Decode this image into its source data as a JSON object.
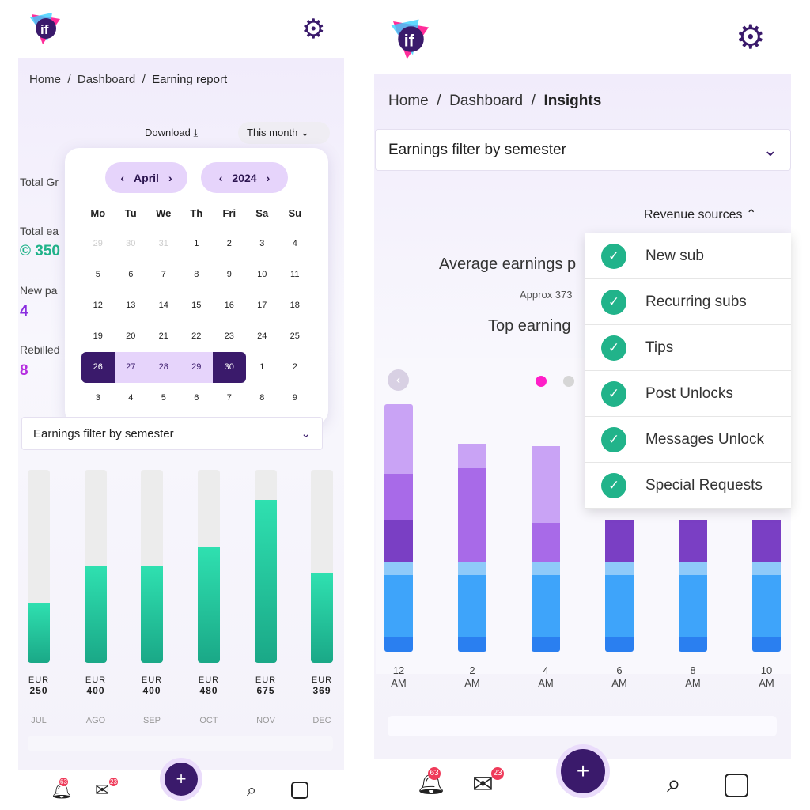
{
  "left": {
    "breadcrumb": [
      "Home",
      "Dashboard",
      "Earning report"
    ],
    "download_label": "Download",
    "period_select": "This month",
    "stats": [
      {
        "label": "Total Gr"
      },
      {
        "label": "Total ea",
        "value": "350"
      },
      {
        "label": "New pa",
        "value": "4"
      },
      {
        "label": "Rebilled",
        "value": "8"
      }
    ],
    "calendar": {
      "month": "April",
      "year": "2024",
      "weekdays": [
        "Mo",
        "Tu",
        "We",
        "Th",
        "Fri",
        "Sa",
        "Su"
      ],
      "days": [
        "29",
        "30",
        "31",
        "1",
        "2",
        "3",
        "4",
        "5",
        "6",
        "7",
        "8",
        "9",
        "10",
        "11",
        "12",
        "13",
        "14",
        "15",
        "16",
        "17",
        "18",
        "19",
        "20",
        "21",
        "22",
        "23",
        "24",
        "25",
        "26",
        "27",
        "28",
        "29",
        "30",
        "1",
        "2",
        "3",
        "4",
        "5",
        "6",
        "7",
        "8",
        "9"
      ],
      "range_start": "26",
      "range_end": "30"
    },
    "filter_select": "Earnings filter by semester",
    "bars": [
      {
        "currency": "EUR",
        "value": 250,
        "month": "JUL"
      },
      {
        "currency": "EUR",
        "value": 400,
        "month": "AGO"
      },
      {
        "currency": "EUR",
        "value": 400,
        "month": "SEP"
      },
      {
        "currency": "EUR",
        "value": 480,
        "month": "OCT"
      },
      {
        "currency": "EUR",
        "value": 675,
        "month": "NOV"
      },
      {
        "currency": "EUR",
        "value": 369,
        "month": "DEC"
      }
    ],
    "badges": {
      "notifications": "63",
      "messages": "23"
    }
  },
  "right": {
    "breadcrumb": [
      "Home",
      "Dashboard",
      "Insights"
    ],
    "filter_select": "Earnings filter by semester",
    "revenue_toggle": "Revenue sources",
    "avg_label": "Average earnings p",
    "approx": "Approx 373",
    "top_label": "Top earning",
    "sources": [
      "New sub",
      "Recurring subs",
      "Tips",
      "Post Unlocks",
      "Messages Unlock",
      "Special Requests"
    ],
    "x_ticks": [
      [
        "12",
        "AM"
      ],
      [
        "2",
        "AM"
      ],
      [
        "4",
        "AM"
      ],
      [
        "6",
        "AM"
      ],
      [
        "8",
        "AM"
      ],
      [
        "10",
        "AM"
      ]
    ],
    "stack_colors": [
      "#c9a3f5",
      "#a86ae8",
      "#7a3fc4",
      "#8fcaf9",
      "#3ea4fa",
      "#2a7ff0"
    ],
    "stacks_percent": [
      [
        28,
        19,
        17,
        5,
        25,
        6
      ],
      [
        10,
        38,
        0,
        5,
        25,
        6
      ],
      [
        31,
        16,
        0,
        5,
        25,
        6
      ],
      [
        0,
        0,
        17,
        5,
        25,
        6
      ],
      [
        0,
        0,
        17,
        5,
        25,
        6
      ],
      [
        0,
        0,
        17,
        5,
        25,
        6
      ]
    ],
    "badges": {
      "notifications": "63",
      "messages": "23"
    }
  },
  "colors": {
    "brand": "#3a1a6b",
    "accent": "#21b38a",
    "pink": "#ff1fc8"
  }
}
